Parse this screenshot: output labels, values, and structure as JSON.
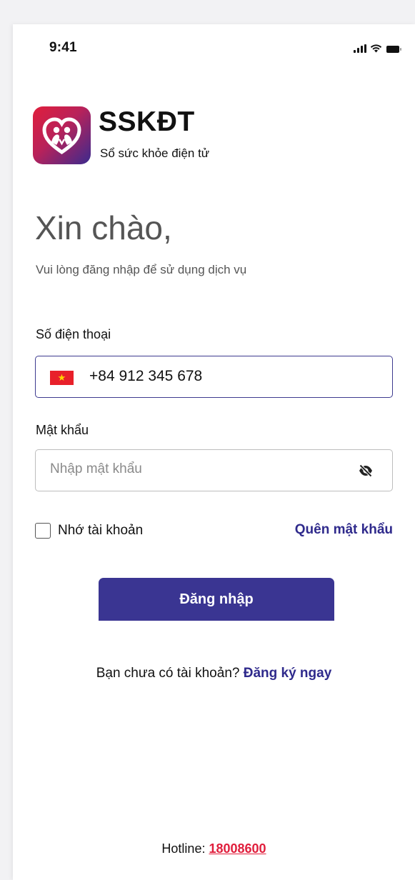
{
  "status_bar": {
    "time": "9:41"
  },
  "brand": {
    "name": "SSKĐT",
    "subtitle": "Sổ sức khỏe điện tử"
  },
  "greeting": {
    "title": "Xin chào,",
    "subtitle": "Vui lòng đăng nhập để sử dụng dịch vụ"
  },
  "phone": {
    "label": "Số điện thoại",
    "value": "+84 912 345 678",
    "country_icon": "vietnam-flag-icon"
  },
  "password": {
    "label": "Mật khẩu",
    "placeholder": "Nhập mật khẩu",
    "toggle_icon": "eye-off-icon"
  },
  "remember": {
    "label": "Nhớ tài khoản",
    "checked": false
  },
  "forgot": {
    "label": "Quên mật khẩu"
  },
  "login": {
    "label": "Đăng nhập"
  },
  "signup": {
    "prompt": "Bạn chưa có tài khoản?",
    "link": "Đăng ký ngay"
  },
  "hotline": {
    "label": "Hotline:",
    "number": "18008600"
  },
  "colors": {
    "primary": "#3a3592",
    "accent": "#e01e3c",
    "link": "#2f2a8c"
  }
}
